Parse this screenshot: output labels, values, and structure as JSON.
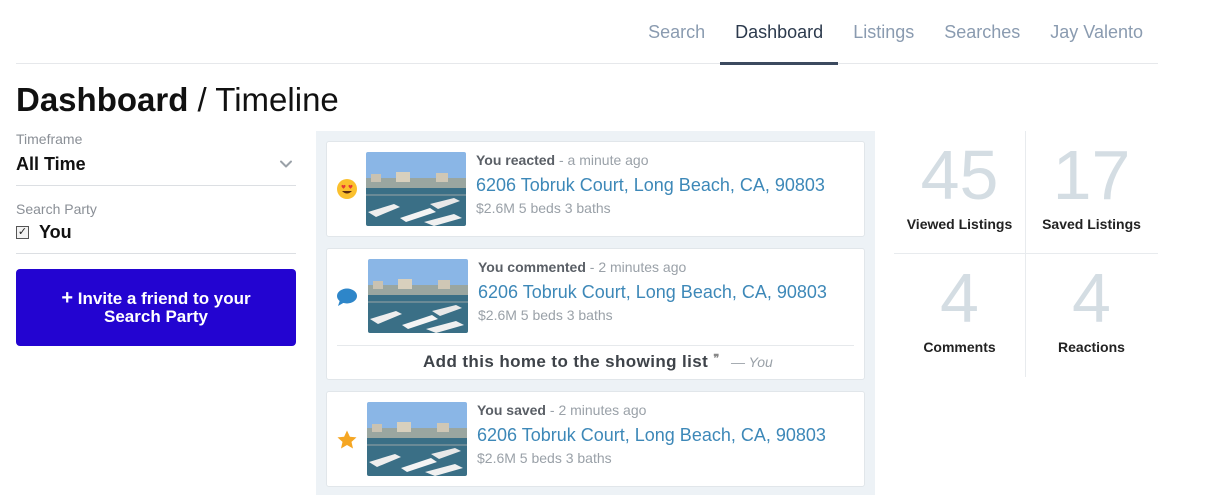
{
  "nav": {
    "items": [
      {
        "label": "Search"
      },
      {
        "label": "Dashboard",
        "active": true
      },
      {
        "label": "Listings"
      },
      {
        "label": "Searches"
      },
      {
        "label": "Jay Valento"
      }
    ]
  },
  "title": {
    "main": "Dashboard",
    "separator": " / ",
    "sub": "Timeline"
  },
  "filters": {
    "timeframe_label": "Timeframe",
    "timeframe_value": "All Time",
    "party_label": "Search Party",
    "party_member": "You",
    "party_checked": true
  },
  "invite_button": {
    "icon": "+",
    "label": "Invite a friend to your Search Party"
  },
  "feed": [
    {
      "icon": "heart-eyes-emoji-icon",
      "who": "You reacted",
      "when": " - a minute ago",
      "address": "6206 Tobruk Court, Long Beach, CA, 90803",
      "specs": "$2.6M 5 beds 3 baths"
    },
    {
      "icon": "speech-bubble-icon",
      "who": "You commented",
      "when": " - 2 minutes ago",
      "address": "6206 Tobruk Court, Long Beach, CA, 90803",
      "specs": "$2.6M 5 beds 3 baths",
      "comment": "Add this home to the showing list",
      "comment_quote": "❞",
      "comment_author": "— You"
    },
    {
      "icon": "star-icon",
      "who": "You saved",
      "when": " - 2 minutes ago",
      "address": "6206 Tobruk Court, Long Beach, CA, 90803",
      "specs": "$2.6M 5 beds 3 baths"
    }
  ],
  "stats": [
    {
      "value": "45",
      "label": "Viewed Listings"
    },
    {
      "value": "17",
      "label": "Saved Listings"
    },
    {
      "value": "4",
      "label": "Comments"
    },
    {
      "value": "4",
      "label": "Reactions"
    }
  ],
  "colors": {
    "accent": "#2304d1",
    "link": "#3d88b8",
    "stat_number": "#d4dde3",
    "feed_bg": "#edf2f6",
    "star": "#f5a623",
    "comment_icon": "#2e86c9"
  }
}
